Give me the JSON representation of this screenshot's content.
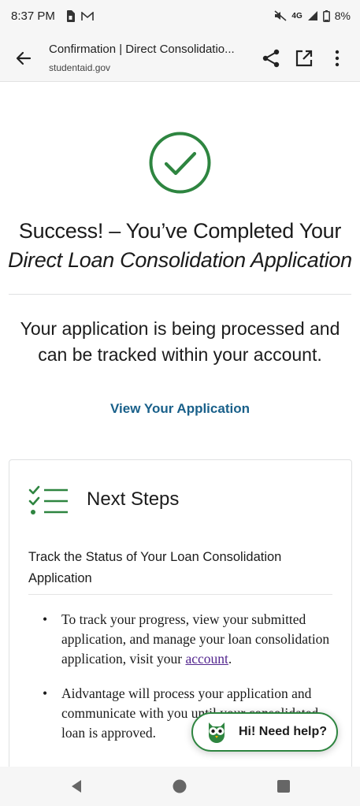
{
  "status_bar": {
    "time": "8:37 PM",
    "network": "4G",
    "battery": "8%"
  },
  "browser": {
    "page_title": "Confirmation | Direct Consolidatio...",
    "domain": "studentaid.gov"
  },
  "main": {
    "success_line1": "Success! – You’ve Completed Your",
    "success_line2": "Direct Loan Consolidation Application",
    "processed_text": "Your application is being processed and can be tracked within your account.",
    "view_link": "View Your Application"
  },
  "next_steps": {
    "heading": "Next Steps",
    "track_heading": "Track the Status of Your Loan Consolidation Application",
    "bullet1_text": "To track your progress, view your submitted application, and manage your loan consolidation application, visit your",
    "bullet1_link": "account",
    "bullet1_end": ".",
    "bullet2_text": "Aidvantage will process your application and communicate with you until your consolidated loan is approved."
  },
  "help_widget": {
    "label": "Hi! Need help?"
  },
  "colors": {
    "success_green": "#2e8540",
    "link_blue": "#19608a",
    "visited_purple": "#54278f"
  }
}
